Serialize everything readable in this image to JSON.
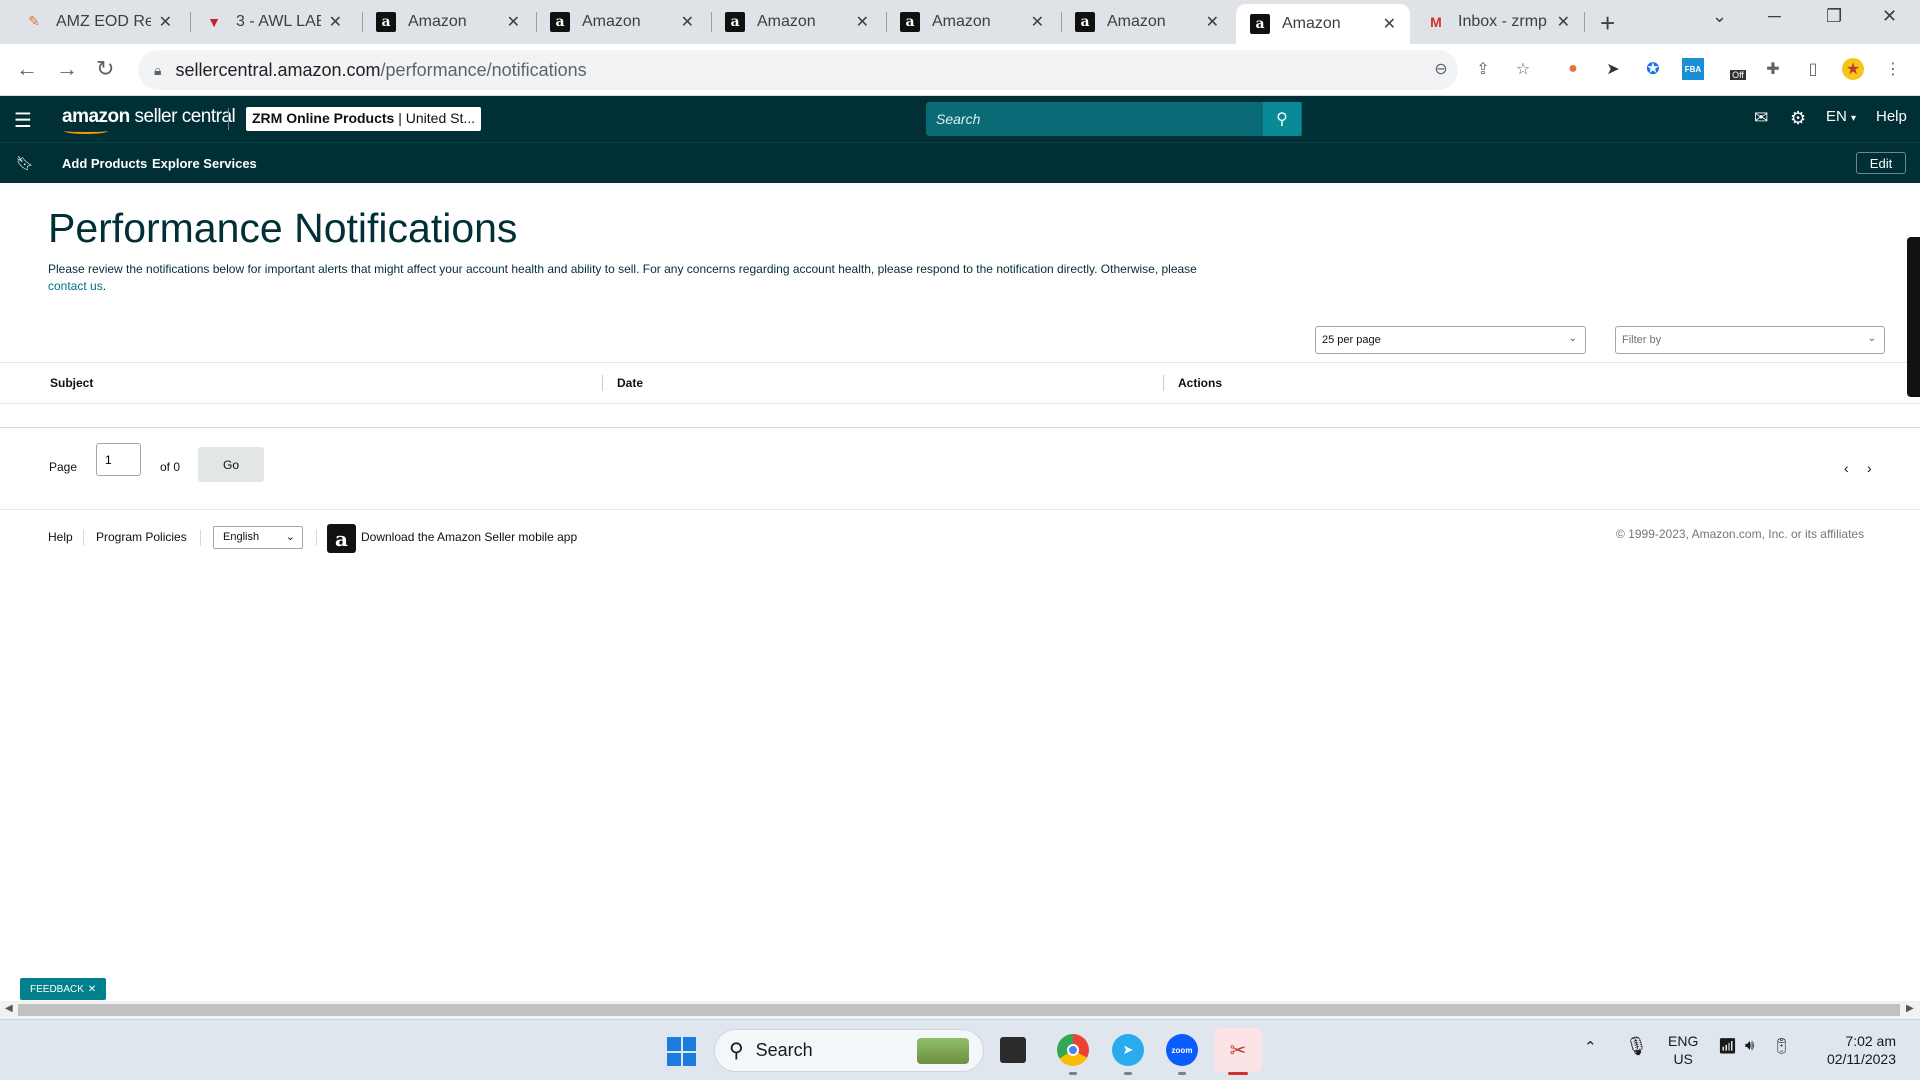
{
  "browser": {
    "tabs": [
      {
        "title": "AMZ EOD Re",
        "favicon": "pen-icon",
        "color": "#e8713c"
      },
      {
        "title": "3 - AWL LABE",
        "favicon": "awl-icon",
        "color": "#cc1f2d"
      },
      {
        "title": "Amazon",
        "favicon": "amazon-icon"
      },
      {
        "title": "Amazon",
        "favicon": "amazon-icon"
      },
      {
        "title": "Amazon",
        "favicon": "amazon-icon"
      },
      {
        "title": "Amazon",
        "favicon": "amazon-icon"
      },
      {
        "title": "Amazon",
        "favicon": "amazon-icon"
      },
      {
        "title": "Amazon",
        "favicon": "amazon-icon",
        "active": true
      },
      {
        "title": "Inbox - zrmp",
        "favicon": "gmail-icon"
      }
    ],
    "url_host": "sellercentral.amazon.com",
    "url_path": "/performance/notifications",
    "extension_badge": "Off",
    "extension_label_fba": "FBA"
  },
  "header": {
    "logo_bold": "amazon",
    "logo_rest": " seller central",
    "store_name": "ZRM Online Products",
    "store_region": " | United St...",
    "search_placeholder": "Search",
    "lang": "EN",
    "help": "Help",
    "brand_color": "#002f36"
  },
  "subnav": {
    "links": [
      "Add Products",
      "Explore Services"
    ],
    "edit": "Edit"
  },
  "page": {
    "title": "Performance Notifications",
    "intro": "Please review the notifications below for important alerts that might affect your account health and ability to sell. For any concerns regarding account health, please respond to the notification directly. Otherwise, please",
    "intro_link": "contact us",
    "per_page": "25 per page",
    "filter_placeholder": "Filter by"
  },
  "table": {
    "columns": [
      "Subject",
      "Date",
      "Actions"
    ],
    "rows": []
  },
  "pager": {
    "page_label": "Page",
    "page_value": "1",
    "of_label": "of 0",
    "go": "Go"
  },
  "footer": {
    "help": "Help",
    "policies": "Program Policies",
    "language": "English",
    "app_text": "Download the Amazon Seller mobile app",
    "copyright": "© 1999-2023, Amazon.com, Inc. or its affiliates"
  },
  "feedback": "FEEDBACK",
  "taskbar": {
    "search": "Search",
    "lang_line1": "ENG",
    "lang_line2": "US",
    "time": "7:02 am",
    "date": "02/11/2023"
  }
}
